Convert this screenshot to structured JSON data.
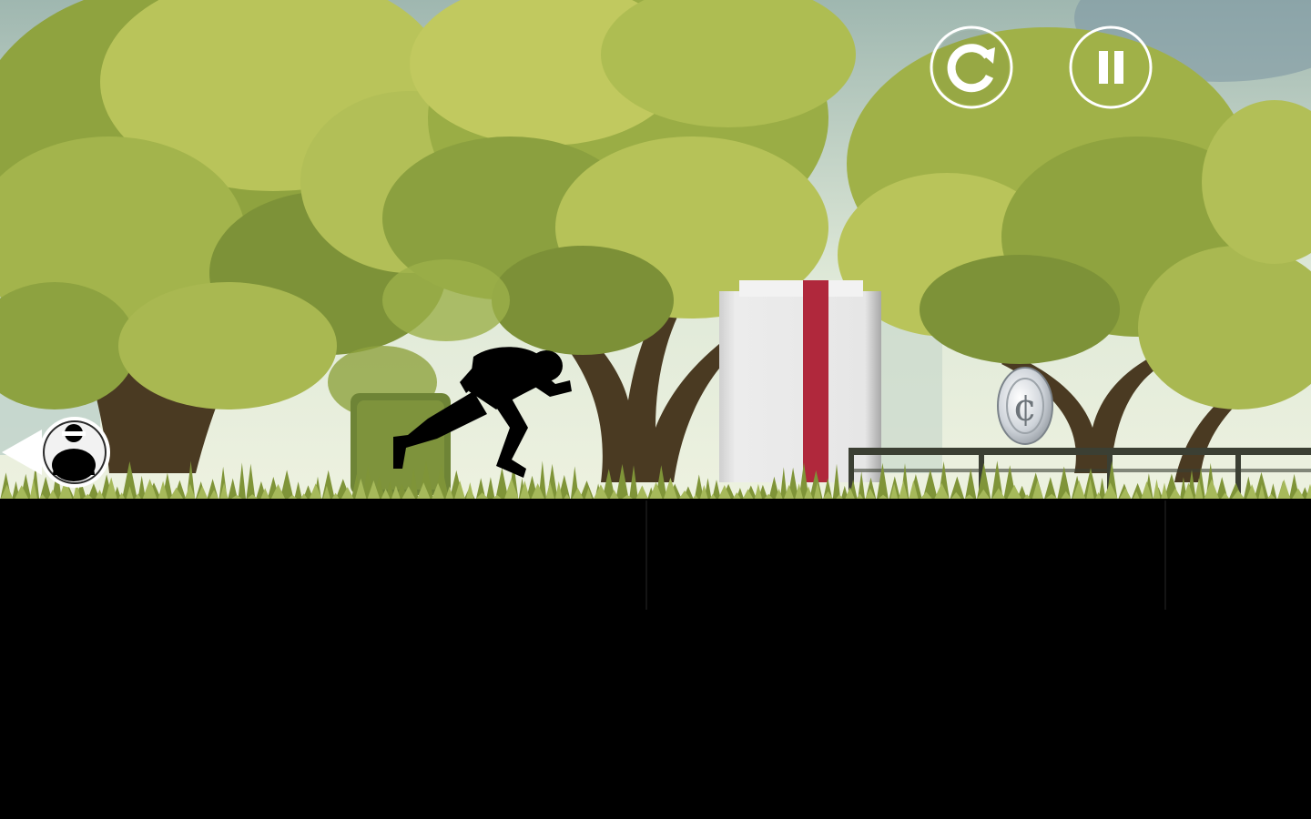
{
  "game": {
    "scene": "forest-park-run",
    "colors": {
      "sky": "#dfe9d8",
      "foliage_light": "#b9c45a",
      "foliage_mid": "#8fa33f",
      "foliage_dark": "#5d7330",
      "trunk": "#4a3a22",
      "ground": "#000000",
      "crate": "#e4e4e4",
      "crate_stripe": "#b0283c",
      "coin": "#d9dde2",
      "hud": "#ffffff"
    }
  },
  "hud": {
    "restart_icon": "restart-icon",
    "pause_icon": "pause-icon"
  },
  "player": {
    "icon": "runner-silhouette"
  },
  "chaser": {
    "icon": "pursuer-indicator-icon"
  },
  "coin": {
    "symbol": "¢",
    "icon": "coin-icon"
  }
}
